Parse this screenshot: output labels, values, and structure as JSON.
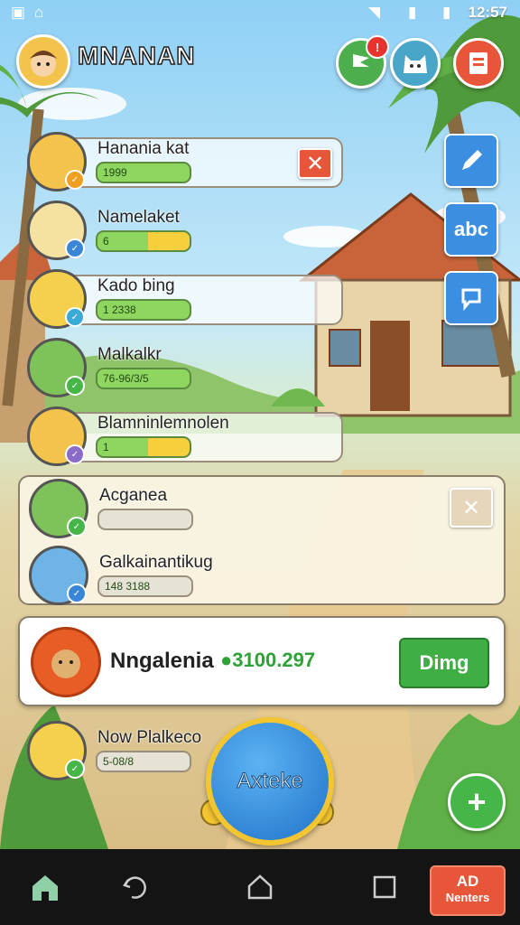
{
  "status_bar": {
    "time": "12:57",
    "icons": [
      "sim-icon",
      "mail-icon",
      "wifi-icon",
      "signal-icon",
      "battery-icon"
    ]
  },
  "header": {
    "player_name": "MNANAN",
    "notification_count": "!"
  },
  "top_buttons": [
    {
      "name": "messages-button",
      "icon": "flag-icon",
      "color": "#4cae4c"
    },
    {
      "name": "cat-button",
      "icon": "cat-icon",
      "color": "#4aa6c8"
    },
    {
      "name": "book-button",
      "icon": "book-icon",
      "color": "#e8563a"
    }
  ],
  "side_buttons": [
    {
      "name": "edit-button",
      "icon": "pencil-icon",
      "label": ""
    },
    {
      "name": "sort-button",
      "icon": "text-icon",
      "label": "abc"
    },
    {
      "name": "chat-button",
      "icon": "chat-icon",
      "label": ""
    }
  ],
  "players": [
    {
      "name": "Hanania kat",
      "score": "1999",
      "bar": "green",
      "avatar_color": "#f4c34c",
      "badge_color": "#f0a020",
      "removable": true
    },
    {
      "name": "Namelaket",
      "score": "6",
      "bar": "yellow",
      "avatar_color": "#f6e2a0",
      "badge_color": "#3a86d6",
      "removable": false
    },
    {
      "name": "Kado bing",
      "score": "1 2338",
      "bar": "green",
      "avatar_color": "#f4d04c",
      "badge_color": "#3aaad6",
      "removable": false
    },
    {
      "name": "Malkalkr",
      "score": "76-96/3/5",
      "bar": "green",
      "avatar_color": "#7ec35a",
      "badge_color": "#46b649",
      "removable": false
    },
    {
      "name": "Blamninlemnolen",
      "score": "1",
      "bar": "yellow",
      "avatar_color": "#f4c34c",
      "badge_color": "#8a6bc8",
      "removable": false
    }
  ],
  "group": {
    "members": [
      {
        "name": "Acganea",
        "score": "",
        "bar": "grey",
        "avatar_color": "#7ec35a",
        "badge_color": "#46b649"
      },
      {
        "name": "Galkainantikug",
        "score": "148 3188",
        "bar": "grey",
        "avatar_color": "#6fb4e6",
        "badge_color": "#3a86d6"
      }
    ]
  },
  "highlight": {
    "name": "Nngalenia",
    "score": "●3100.297",
    "button_label": "Dimg"
  },
  "bottom_player": {
    "name": "Now Plalkeco",
    "score": "5-08/8",
    "avatar_color": "#f4d04c",
    "badge_color": "#46b649"
  },
  "action_button": {
    "label": "Axteke"
  },
  "nav": {
    "ad_line1": "AD",
    "ad_line2": "Nenters"
  }
}
